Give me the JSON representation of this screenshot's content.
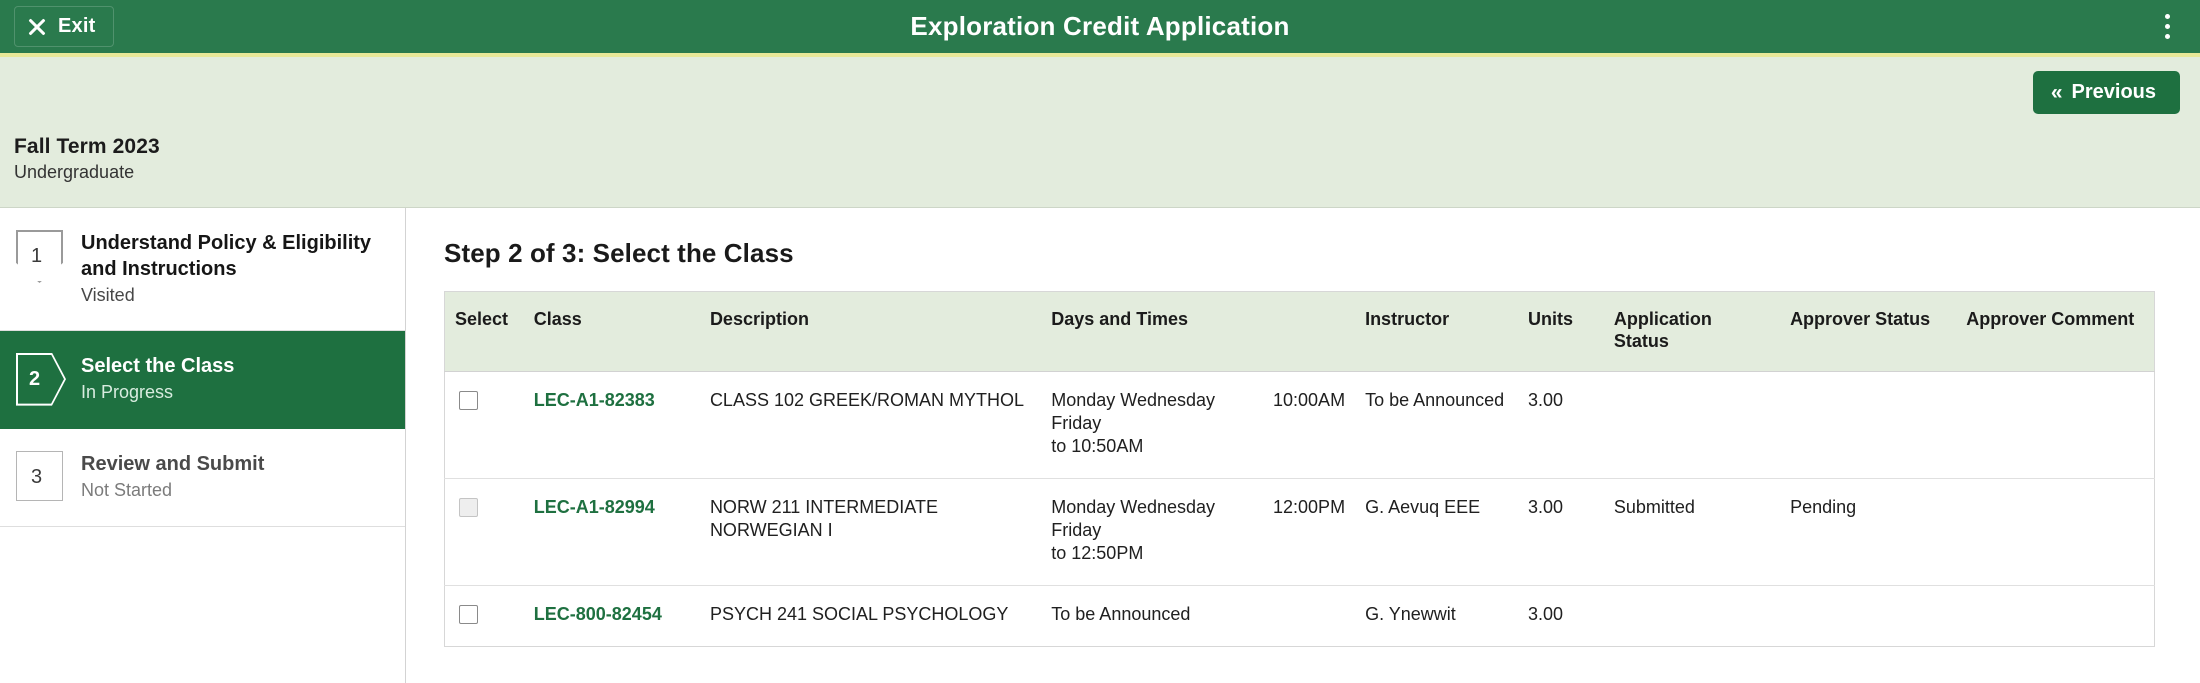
{
  "header": {
    "exit_label": "Exit",
    "title": "Exploration Credit Application",
    "exit_icon": "close-x-icon",
    "menu_icon": "kebab-menu-icon"
  },
  "subbar": {
    "previous_label": "Previous",
    "previous_icon": "chevron-left-double-icon",
    "term_name": "Fall Term 2023",
    "career": "Undergraduate"
  },
  "sidebar": {
    "steps": [
      {
        "number": "1",
        "title": "Understand Policy & Eligibility and Instructions",
        "status": "Visited"
      },
      {
        "number": "2",
        "title": "Select the Class",
        "status": "In Progress"
      },
      {
        "number": "3",
        "title": "Review and Submit",
        "status": "Not Started"
      }
    ]
  },
  "main": {
    "heading": "Step 2 of 3: Select the Class",
    "table": {
      "columns": [
        "Select",
        "Class",
        "Description",
        "Days and Times",
        "Instructor",
        "Units",
        "Application Status",
        "Approver Status",
        "Approver Comment"
      ],
      "rows": [
        {
          "class": "LEC-A1-82383",
          "description": "CLASS 102  GREEK/ROMAN MYTHOL",
          "days": "Monday Wednesday Friday",
          "time": "10:00AM to 10:50AM",
          "days_line1": "Monday Wednesday Friday",
          "time_line1": "10:00AM",
          "days_line2": "to 10:50AM",
          "instructor": "To be Announced",
          "units": "3.00",
          "application_status": "",
          "approver_status": "",
          "approver_comment": "",
          "checkbox_disabled": false
        },
        {
          "class": "LEC-A1-82994",
          "description": "NORW 211  INTERMEDIATE NORWEGIAN I",
          "days": "Monday Wednesday Friday",
          "time": "12:00PM to 12:50PM",
          "days_line1": "Monday Wednesday Friday",
          "time_line1": "12:00PM",
          "days_line2": "to 12:50PM",
          "instructor": "G. Aevuq EEE",
          "units": "3.00",
          "application_status": "Submitted",
          "approver_status": "Pending",
          "approver_comment": "",
          "checkbox_disabled": true
        },
        {
          "class": "LEC-800-82454",
          "description": "PSYCH 241  SOCIAL PSYCHOLOGY",
          "days": "To be Announced",
          "time": "",
          "days_line1": "To be Announced",
          "time_line1": "",
          "days_line2": "",
          "instructor": "G. Ynewwit",
          "units": "3.00",
          "application_status": "",
          "approver_status": "",
          "approver_comment": "",
          "checkbox_disabled": false
        }
      ]
    }
  },
  "colors": {
    "header_green": "#2a7a4d",
    "accent_green": "#1e7040",
    "yellow_rule": "#e8e898",
    "band_green": "#e3ecdd"
  }
}
